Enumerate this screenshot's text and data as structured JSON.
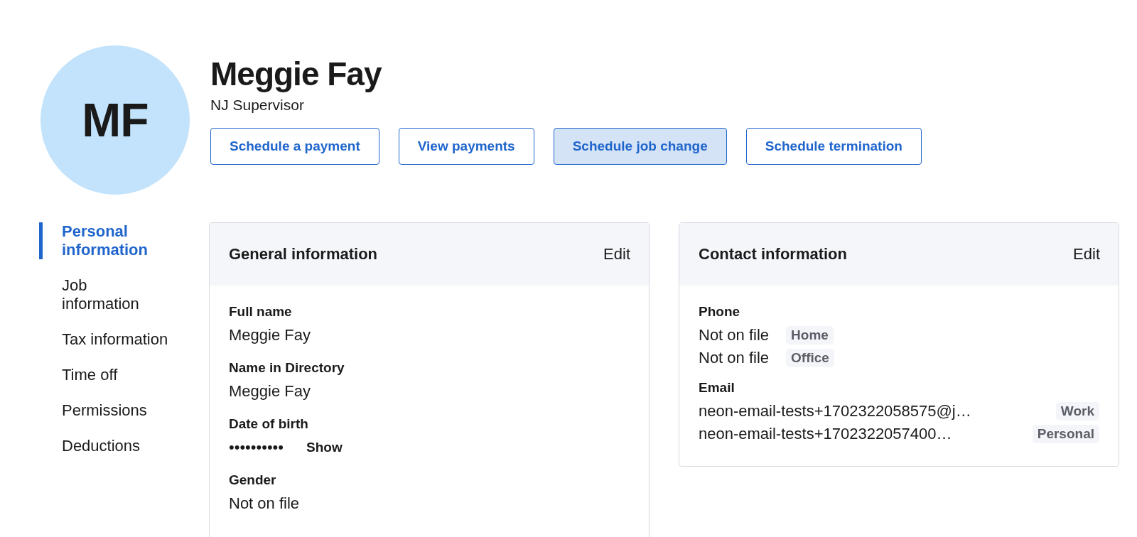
{
  "profile": {
    "initials": "MF",
    "name": "Meggie Fay",
    "title": "NJ Supervisor"
  },
  "actions": [
    {
      "label": "Schedule a payment",
      "highlighted": false
    },
    {
      "label": "View payments",
      "highlighted": false
    },
    {
      "label": "Schedule job change",
      "highlighted": true
    },
    {
      "label": "Schedule termination",
      "highlighted": false
    }
  ],
  "sidebar": {
    "items": [
      {
        "label": "Personal information",
        "selected": true
      },
      {
        "label": "Job information",
        "selected": false
      },
      {
        "label": "Tax information",
        "selected": false
      },
      {
        "label": "Time off",
        "selected": false
      },
      {
        "label": "Permissions",
        "selected": false
      },
      {
        "label": "Deductions",
        "selected": false
      }
    ]
  },
  "general_information": {
    "title": "General information",
    "edit": "Edit",
    "fields": [
      {
        "label": "Full name",
        "value": "Meggie Fay"
      },
      {
        "label": "Name in Directory",
        "value": "Meggie Fay"
      },
      {
        "label": "Date of birth",
        "value": "••••••••••",
        "action": "Show"
      },
      {
        "label": "Gender",
        "value": "Not on file"
      }
    ]
  },
  "contact_information": {
    "title": "Contact information",
    "edit": "Edit",
    "groups": [
      {
        "label": "Phone",
        "entries": [
          {
            "value": "Not on file",
            "tag": "Home"
          },
          {
            "value": "Not on file",
            "tag": "Office"
          }
        ]
      },
      {
        "label": "Email",
        "entries": [
          {
            "value": "neon-email-tests+1702322058575@j…",
            "tag": "Work"
          },
          {
            "value": "neon-email-tests+1702322057400…",
            "tag": "Personal"
          }
        ]
      }
    ]
  }
}
